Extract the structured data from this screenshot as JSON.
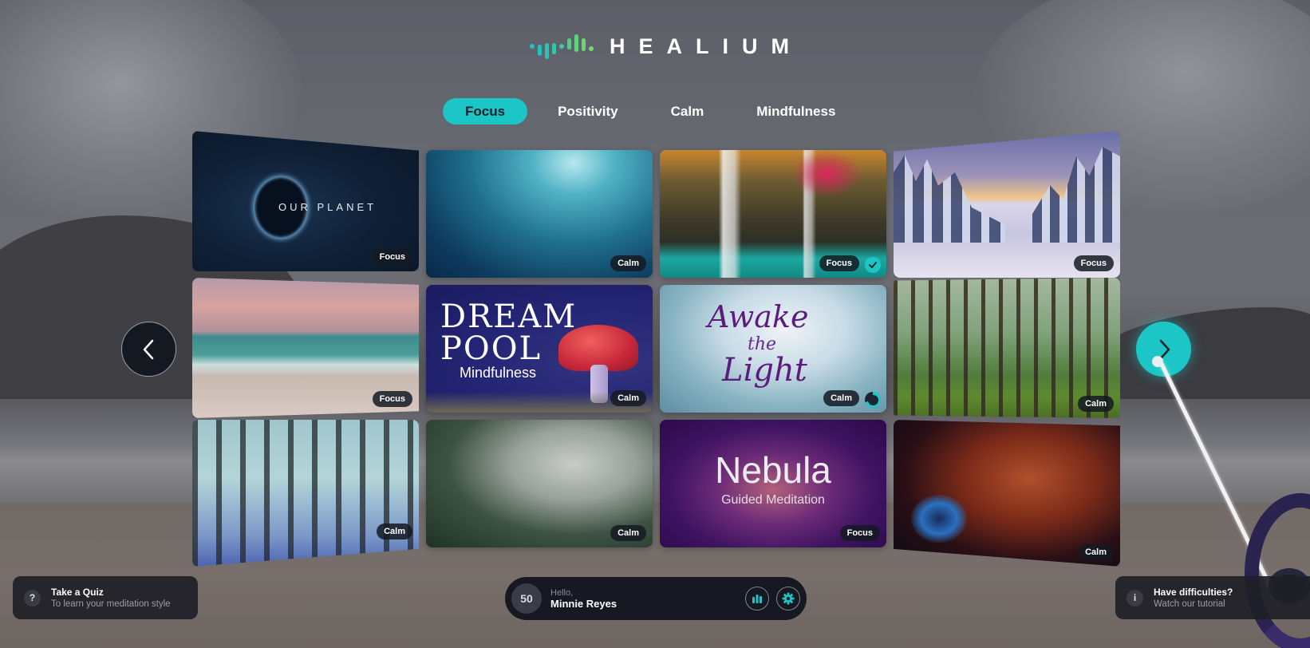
{
  "app": {
    "name": "HEALIUM",
    "accent_color": "#1cc6c6"
  },
  "tabs": [
    {
      "label": "Focus",
      "active": true
    },
    {
      "label": "Positivity",
      "active": false
    },
    {
      "label": "Calm",
      "active": false
    },
    {
      "label": "Mindfulness",
      "active": false
    }
  ],
  "tiles": [
    {
      "name": "our-planet",
      "title": "OUR PLANET",
      "category": "Focus",
      "status": null
    },
    {
      "name": "underwater",
      "title": "",
      "category": "Calm",
      "status": null
    },
    {
      "name": "waterfall",
      "title": "",
      "category": "Focus",
      "status": "completed"
    },
    {
      "name": "snowy-forest",
      "title": "",
      "category": "Focus",
      "status": null
    },
    {
      "name": "beach-sunset",
      "title": "",
      "category": "Focus",
      "status": null
    },
    {
      "name": "dream-pool",
      "title": "DREAM POOL",
      "subtitle": "Mindfulness",
      "category": "Calm",
      "status": null
    },
    {
      "name": "awake-the-light",
      "title_lines": [
        "Awake",
        "the",
        "Light"
      ],
      "category": "Calm",
      "status": "in-progress"
    },
    {
      "name": "green-forest",
      "title": "",
      "category": "Calm",
      "status": null
    },
    {
      "name": "bluebell-forest",
      "title": "",
      "category": "Calm",
      "status": null
    },
    {
      "name": "misty-pines",
      "title": "",
      "category": "Calm",
      "status": null
    },
    {
      "name": "nebula",
      "title": "Nebula",
      "subtitle": "Guided Meditation",
      "category": "Focus",
      "status": null
    },
    {
      "name": "deep-space",
      "title": "",
      "category": "Calm",
      "status": null
    }
  ],
  "nav": {
    "prev_icon": "chevron-left-icon",
    "next_icon": "chevron-right-icon"
  },
  "quiz_panel": {
    "icon": "?",
    "title": "Take a Quiz",
    "subtitle": "To learn your meditation style"
  },
  "help_panel": {
    "icon": "i",
    "title": "Have difficulties?",
    "subtitle": "Watch our tutorial"
  },
  "user": {
    "score": "50",
    "greeting": "Hello,",
    "name": "Minnie Reyes",
    "stats_icon": "bar-chart-icon",
    "settings_icon": "gear-icon"
  }
}
